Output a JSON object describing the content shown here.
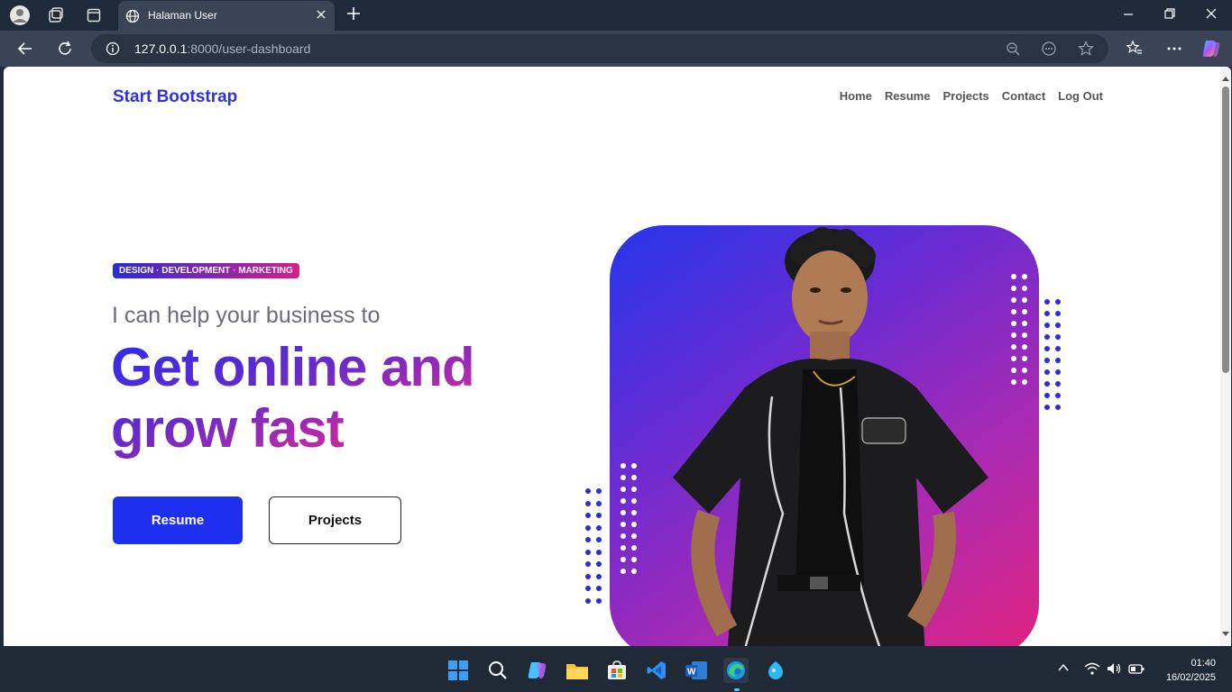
{
  "browser": {
    "tab_title": "Halaman User",
    "url_host": "127.0.0.1",
    "url_path": ":8000/user-dashboard"
  },
  "site": {
    "brand": "Start Bootstrap",
    "nav": [
      "Home",
      "Resume",
      "Projects",
      "Contact",
      "Log Out"
    ]
  },
  "hero": {
    "badge": "DESIGN · DEVELOPMENT · MARKETING",
    "lead": "I can help your business to",
    "headline_line1": "Get online and",
    "headline_line2": "grow fast",
    "primary_button": "Resume",
    "secondary_button": "Projects"
  },
  "taskbar": {
    "time": "01:40",
    "date": "16/02/2025"
  }
}
